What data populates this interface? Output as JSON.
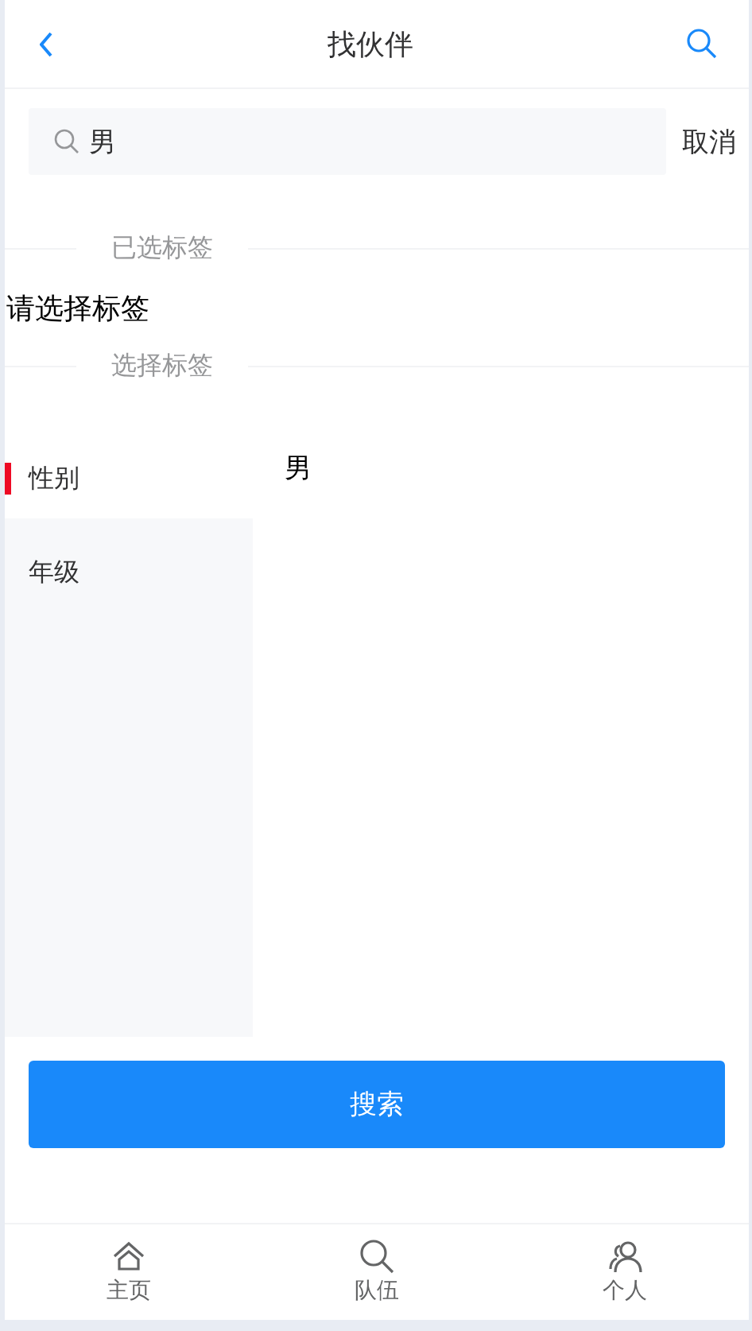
{
  "header": {
    "title": "找伙伴"
  },
  "search": {
    "value": "男",
    "cancel": "取消"
  },
  "selected_section": {
    "heading": "已选标签",
    "placeholder": "请选择标签"
  },
  "choose_section": {
    "heading": "选择标签"
  },
  "categories": [
    {
      "label": "性别",
      "selected": true
    },
    {
      "label": "年级",
      "selected": false
    }
  ],
  "options": [
    "男"
  ],
  "search_button": "搜索",
  "tabbar": [
    {
      "label": "主页",
      "kind": "home"
    },
    {
      "label": "队伍",
      "kind": "search"
    },
    {
      "label": "个人",
      "kind": "people"
    }
  ]
}
